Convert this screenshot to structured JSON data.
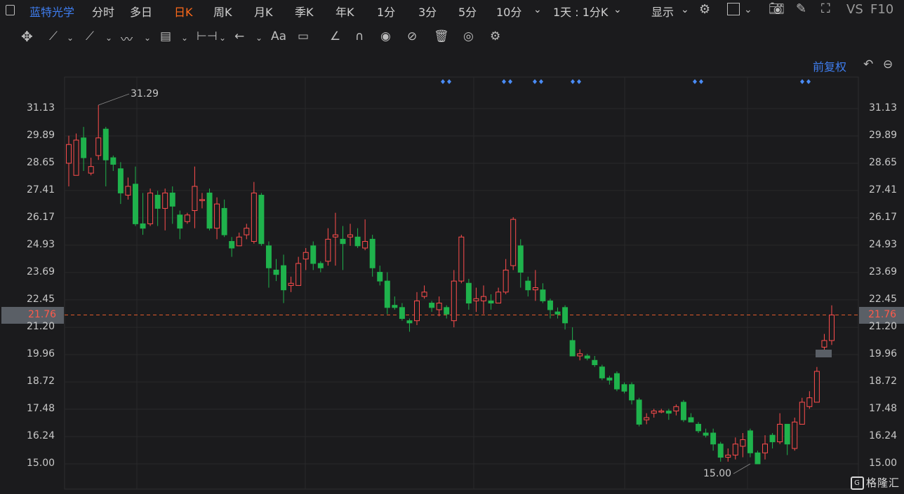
{
  "header": {
    "stock_name": "蓝特光学",
    "periods": [
      {
        "label": "分时",
        "x": 131
      },
      {
        "label": "多日",
        "x": 185
      },
      {
        "label": "日K",
        "x": 248,
        "active": true
      },
      {
        "label": "周K",
        "x": 304
      },
      {
        "label": "月K",
        "x": 362
      },
      {
        "label": "季K",
        "x": 420
      },
      {
        "label": "年K",
        "x": 478
      },
      {
        "label": "1分",
        "x": 537
      },
      {
        "label": "3分",
        "x": 596
      },
      {
        "label": "5分",
        "x": 653
      },
      {
        "label": "10分",
        "x": 707
      }
    ],
    "period_more": "⌄",
    "interval_select": "1天 : 1分K",
    "display_label": "显示",
    "vs_label": "VS",
    "f10_label": "F10"
  },
  "toolbar_icons": [
    "move-icon",
    "line-icon",
    "polyline-icon",
    "wave-icon",
    "fib-icon",
    "measure-icon",
    "arrow-icon",
    "text-icon",
    "comment-icon",
    "angle-icon",
    "magnet-icon",
    "eye-icon",
    "hide-icon",
    "trash-icon",
    "compare-icon",
    "settings-icon"
  ],
  "adjust_label": "前复权",
  "price_axis": [
    "31.13",
    "29.89",
    "28.65",
    "27.41",
    "26.17",
    "24.93",
    "23.69",
    "22.45",
    "21.20",
    "19.96",
    "18.72",
    "17.48",
    "16.24",
    "15.00"
  ],
  "current_price": "21.76",
  "colors": {
    "up": "#ff4d4d",
    "down": "#1fb24c",
    "accent": "#3f7ef0",
    "active_tab": "#ff6a1a",
    "dashed": "#e05a2a"
  },
  "watermark": "格隆汇",
  "chart_data": {
    "type": "candlestick",
    "ylim": [
      15.0,
      31.13
    ],
    "max_label": "31.29",
    "min_label": "15.00",
    "current": 21.76,
    "signal_marks_count": 6,
    "candles": [
      {
        "o": 28.65,
        "c": 29.5,
        "h": 29.9,
        "l": 27.6
      },
      {
        "o": 28.1,
        "c": 29.7,
        "h": 30.0,
        "l": 28.1
      },
      {
        "o": 29.8,
        "c": 28.9,
        "h": 30.3,
        "l": 28.3
      },
      {
        "o": 28.2,
        "c": 28.5,
        "h": 28.9,
        "l": 28.1
      },
      {
        "o": 29.0,
        "c": 29.8,
        "h": 31.29,
        "l": 28.8
      },
      {
        "o": 30.2,
        "c": 28.8,
        "h": 30.3,
        "l": 27.6
      },
      {
        "o": 28.9,
        "c": 28.6,
        "h": 29.0,
        "l": 28.3
      },
      {
        "o": 28.4,
        "c": 27.3,
        "h": 28.7,
        "l": 26.8
      },
      {
        "o": 27.2,
        "c": 27.6,
        "h": 28.0,
        "l": 27.0
      },
      {
        "o": 27.7,
        "c": 25.9,
        "h": 28.5,
        "l": 25.8
      },
      {
        "o": 25.9,
        "c": 25.7,
        "h": 27.3,
        "l": 25.4
      },
      {
        "o": 25.9,
        "c": 27.3,
        "h": 27.5,
        "l": 25.8
      },
      {
        "o": 27.2,
        "c": 26.6,
        "h": 27.4,
        "l": 25.8
      },
      {
        "o": 26.6,
        "c": 27.3,
        "h": 27.5,
        "l": 25.6
      },
      {
        "o": 27.3,
        "c": 26.7,
        "h": 27.6,
        "l": 25.9
      },
      {
        "o": 26.3,
        "c": 25.7,
        "h": 26.5,
        "l": 25.2
      },
      {
        "o": 26.0,
        "c": 26.3,
        "h": 26.4,
        "l": 25.9
      },
      {
        "o": 26.5,
        "c": 27.6,
        "h": 28.5,
        "l": 25.7
      },
      {
        "o": 27.0,
        "c": 27.0,
        "h": 27.3,
        "l": 26.6
      },
      {
        "o": 27.3,
        "c": 25.7,
        "h": 27.5,
        "l": 25.6
      },
      {
        "o": 25.7,
        "c": 26.8,
        "h": 27.1,
        "l": 25.2
      },
      {
        "o": 26.6,
        "c": 25.4,
        "h": 27.0,
        "l": 25.3
      },
      {
        "o": 25.1,
        "c": 24.8,
        "h": 25.3,
        "l": 24.4
      },
      {
        "o": 24.9,
        "c": 25.3,
        "h": 25.5,
        "l": 24.9
      },
      {
        "o": 25.4,
        "c": 25.7,
        "h": 25.9,
        "l": 25.2
      },
      {
        "o": 25.1,
        "c": 27.3,
        "h": 27.8,
        "l": 25.0
      },
      {
        "o": 27.2,
        "c": 25.0,
        "h": 27.3,
        "l": 24.9
      },
      {
        "o": 24.9,
        "c": 23.9,
        "h": 25.1,
        "l": 23.0
      },
      {
        "o": 23.8,
        "c": 23.6,
        "h": 24.3,
        "l": 23.3
      },
      {
        "o": 24.0,
        "c": 22.9,
        "h": 24.5,
        "l": 22.3
      },
      {
        "o": 23.1,
        "c": 23.2,
        "h": 23.5,
        "l": 22.8
      },
      {
        "o": 23.1,
        "c": 24.1,
        "h": 24.4,
        "l": 23.1
      },
      {
        "o": 24.3,
        "c": 24.6,
        "h": 24.8,
        "l": 23.8
      },
      {
        "o": 24.9,
        "c": 24.1,
        "h": 25.1,
        "l": 23.8
      },
      {
        "o": 24.1,
        "c": 23.9,
        "h": 24.2,
        "l": 23.7
      },
      {
        "o": 24.2,
        "c": 25.2,
        "h": 25.7,
        "l": 24.0
      },
      {
        "o": 25.3,
        "c": 25.4,
        "h": 26.4,
        "l": 24.0
      },
      {
        "o": 25.2,
        "c": 25.0,
        "h": 25.8,
        "l": 23.8
      },
      {
        "o": 25.3,
        "c": 25.4,
        "h": 25.9,
        "l": 24.9
      },
      {
        "o": 25.3,
        "c": 24.9,
        "h": 25.7,
        "l": 24.8
      },
      {
        "o": 24.8,
        "c": 25.1,
        "h": 26.1,
        "l": 24.7
      },
      {
        "o": 25.2,
        "c": 23.9,
        "h": 25.4,
        "l": 23.5
      },
      {
        "o": 23.7,
        "c": 23.3,
        "h": 24.0,
        "l": 23.1
      },
      {
        "o": 23.3,
        "c": 22.1,
        "h": 23.7,
        "l": 21.8
      },
      {
        "o": 22.2,
        "c": 22.1,
        "h": 22.6,
        "l": 22.0
      },
      {
        "o": 22.1,
        "c": 21.6,
        "h": 22.3,
        "l": 21.5
      },
      {
        "o": 21.5,
        "c": 21.4,
        "h": 21.6,
        "l": 21.0
      },
      {
        "o": 21.5,
        "c": 22.4,
        "h": 22.8,
        "l": 21.3
      },
      {
        "o": 22.6,
        "c": 22.8,
        "h": 23.1,
        "l": 22.5
      },
      {
        "o": 22.3,
        "c": 22.1,
        "h": 22.4,
        "l": 21.9
      },
      {
        "o": 22.0,
        "c": 22.3,
        "h": 22.6,
        "l": 21.7
      },
      {
        "o": 22.1,
        "c": 21.8,
        "h": 22.2,
        "l": 21.6
      },
      {
        "o": 21.5,
        "c": 23.3,
        "h": 23.8,
        "l": 21.2
      },
      {
        "o": 23.3,
        "c": 25.3,
        "h": 25.4,
        "l": 23.2
      },
      {
        "o": 23.2,
        "c": 22.3,
        "h": 23.4,
        "l": 22.0
      },
      {
        "o": 22.4,
        "c": 22.5,
        "h": 23.0,
        "l": 21.9
      },
      {
        "o": 22.4,
        "c": 22.6,
        "h": 23.1,
        "l": 21.8
      },
      {
        "o": 22.4,
        "c": 22.3,
        "h": 22.7,
        "l": 22.0
      },
      {
        "o": 22.3,
        "c": 22.8,
        "h": 23.0,
        "l": 22.3
      },
      {
        "o": 22.8,
        "c": 23.8,
        "h": 24.3,
        "l": 22.7
      },
      {
        "o": 24.0,
        "c": 26.1,
        "h": 26.2,
        "l": 23.8
      },
      {
        "o": 24.9,
        "c": 23.7,
        "h": 25.2,
        "l": 23.0
      },
      {
        "o": 23.3,
        "c": 22.9,
        "h": 23.5,
        "l": 22.6
      },
      {
        "o": 22.9,
        "c": 23.0,
        "h": 23.8,
        "l": 22.4
      },
      {
        "o": 22.9,
        "c": 22.4,
        "h": 23.2,
        "l": 22.3
      },
      {
        "o": 22.4,
        "c": 22.0,
        "h": 22.5,
        "l": 21.6
      },
      {
        "o": 21.9,
        "c": 21.8,
        "h": 22.1,
        "l": 21.6
      },
      {
        "o": 22.1,
        "c": 21.4,
        "h": 22.2,
        "l": 21.1
      },
      {
        "o": 20.6,
        "c": 19.9,
        "h": 21.2,
        "l": 19.9
      },
      {
        "o": 19.9,
        "c": 20.0,
        "h": 20.2,
        "l": 19.7
      },
      {
        "o": 19.9,
        "c": 19.8,
        "h": 20.0,
        "l": 19.7
      },
      {
        "o": 19.7,
        "c": 19.5,
        "h": 19.9,
        "l": 19.4
      },
      {
        "o": 19.4,
        "c": 18.9,
        "h": 19.5,
        "l": 18.8
      },
      {
        "o": 18.9,
        "c": 18.8,
        "h": 19.0,
        "l": 18.6
      },
      {
        "o": 19.1,
        "c": 18.4,
        "h": 19.2,
        "l": 18.3
      },
      {
        "o": 18.6,
        "c": 18.3,
        "h": 18.7,
        "l": 18.2
      },
      {
        "o": 18.6,
        "c": 17.9,
        "h": 18.7,
        "l": 17.7
      },
      {
        "o": 17.9,
        "c": 16.8,
        "h": 18.0,
        "l": 16.7
      },
      {
        "o": 17.0,
        "c": 17.1,
        "h": 17.3,
        "l": 16.8
      },
      {
        "o": 17.3,
        "c": 17.4,
        "h": 17.5,
        "l": 17.1
      },
      {
        "o": 17.4,
        "c": 17.4,
        "h": 17.5,
        "l": 17.3
      },
      {
        "o": 17.4,
        "c": 17.3,
        "h": 17.5,
        "l": 17.0
      },
      {
        "o": 17.4,
        "c": 17.6,
        "h": 17.7,
        "l": 17.2
      },
      {
        "o": 17.8,
        "c": 17.0,
        "h": 17.9,
        "l": 16.9
      },
      {
        "o": 17.1,
        "c": 16.9,
        "h": 17.3,
        "l": 16.9
      },
      {
        "o": 16.8,
        "c": 16.5,
        "h": 16.9,
        "l": 16.4
      },
      {
        "o": 16.4,
        "c": 16.3,
        "h": 16.6,
        "l": 16.2
      },
      {
        "o": 16.4,
        "c": 15.9,
        "h": 16.6,
        "l": 15.6
      },
      {
        "o": 15.9,
        "c": 15.3,
        "h": 16.0,
        "l": 15.1
      },
      {
        "o": 15.3,
        "c": 15.4,
        "h": 15.7,
        "l": 15.1
      },
      {
        "o": 15.4,
        "c": 15.9,
        "h": 16.2,
        "l": 15.2
      },
      {
        "o": 15.8,
        "c": 16.1,
        "h": 16.4,
        "l": 15.3
      },
      {
        "o": 16.5,
        "c": 15.5,
        "h": 16.6,
        "l": 15.3
      },
      {
        "o": 15.5,
        "c": 15.0,
        "h": 15.6,
        "l": 15.0
      },
      {
        "o": 15.5,
        "c": 15.9,
        "h": 16.3,
        "l": 15.2
      },
      {
        "o": 16.3,
        "c": 16.0,
        "h": 16.4,
        "l": 15.7
      },
      {
        "o": 16.0,
        "c": 16.8,
        "h": 17.3,
        "l": 15.9
      },
      {
        "o": 16.8,
        "c": 15.9,
        "h": 16.8,
        "l": 15.4
      },
      {
        "o": 15.7,
        "c": 16.9,
        "h": 17.1,
        "l": 15.6
      },
      {
        "o": 16.8,
        "c": 17.8,
        "h": 18.0,
        "l": 16.8
      },
      {
        "o": 17.6,
        "c": 18.0,
        "h": 18.3,
        "l": 17.5
      },
      {
        "o": 17.8,
        "c": 19.2,
        "h": 19.4,
        "l": 17.8
      },
      {
        "o": 20.3,
        "c": 20.6,
        "h": 20.9,
        "l": 20.0
      },
      {
        "o": 20.6,
        "c": 21.76,
        "h": 22.2,
        "l": 20.4
      }
    ]
  }
}
